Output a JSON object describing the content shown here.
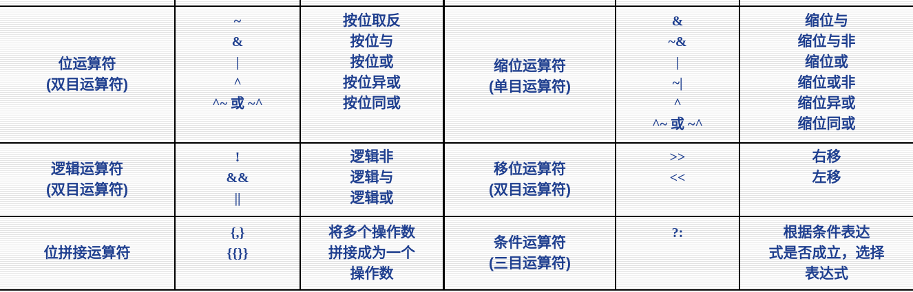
{
  "operators_table": {
    "rows": [
      {
        "left_category": [
          "位运算符",
          "(双目运算符)"
        ],
        "left_symbols": [
          "~",
          "&",
          "|",
          "^",
          "^~ 或 ~^"
        ],
        "left_meanings": [
          "按位取反",
          "按位与",
          "按位或",
          "按位异或",
          "按位同或"
        ],
        "right_category": [
          "缩位运算符",
          "(单目运算符)"
        ],
        "right_symbols": [
          "&",
          "~&",
          "|",
          "~|",
          "^",
          "^~ 或 ~^"
        ],
        "right_meanings": [
          "缩位与",
          "缩位与非",
          "缩位或",
          "缩位或非",
          "缩位异或",
          "缩位同或"
        ]
      },
      {
        "left_category": [
          "逻辑运算符",
          "(双目运算符)"
        ],
        "left_symbols": [
          "!",
          "&&",
          "||"
        ],
        "left_meanings": [
          "逻辑非",
          "逻辑与",
          "逻辑或"
        ],
        "right_category": [
          "移位运算符",
          "(双目运算符)"
        ],
        "right_symbols": [
          ">>",
          "<<"
        ],
        "right_meanings": [
          "右移",
          "左移"
        ]
      },
      {
        "left_category": [
          "位拼接运算符"
        ],
        "left_symbols": [
          "{,}",
          "{{}}"
        ],
        "left_meanings": [
          "将多个操作数",
          "拼接成为一个",
          "操作数"
        ],
        "right_category": [
          "条件运算符",
          "(三目运算符)"
        ],
        "right_symbols": [
          "?:"
        ],
        "right_meanings": [
          "根据条件表达",
          "式是否成立，选择",
          "表达式"
        ]
      }
    ]
  }
}
